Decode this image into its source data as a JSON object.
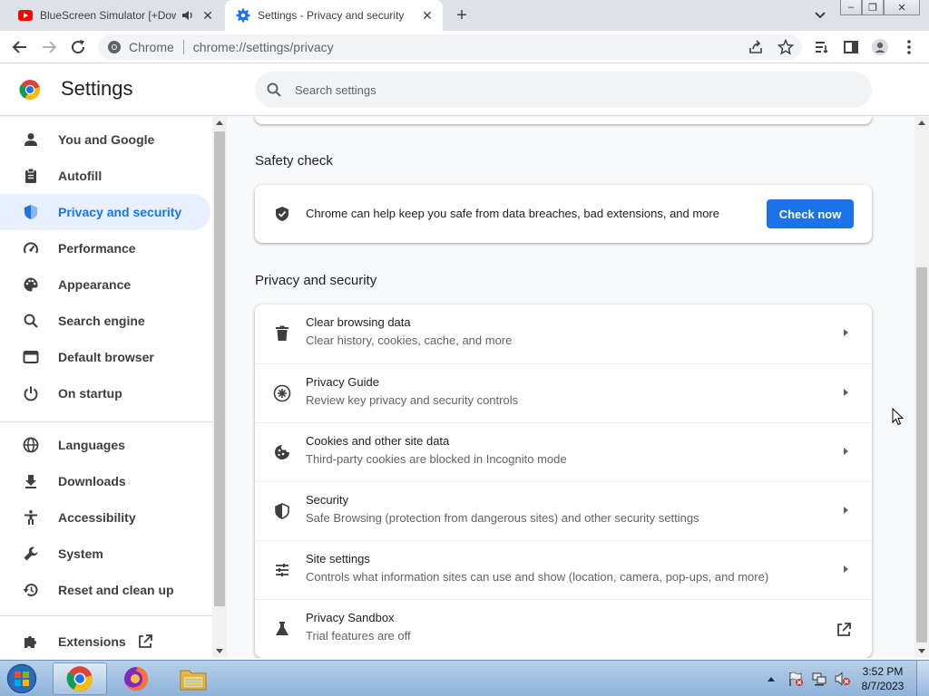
{
  "tabs": [
    {
      "title": "BlueScreen Simulator [+Dow",
      "favicon": "youtube-icon",
      "audio": "speaker-icon"
    },
    {
      "title": "Settings - Privacy and security",
      "favicon": "gear-icon"
    }
  ],
  "omnibox": {
    "chrome_label": "Chrome",
    "url": "chrome://settings/privacy"
  },
  "header": {
    "title": "Settings",
    "search_placeholder": "Search settings"
  },
  "sidebar": {
    "items": [
      {
        "label": "You and Google",
        "icon": "person-icon"
      },
      {
        "label": "Autofill",
        "icon": "clipboard-icon"
      },
      {
        "label": "Privacy and security",
        "icon": "shield-icon",
        "active": true
      },
      {
        "label": "Performance",
        "icon": "speedometer-icon"
      },
      {
        "label": "Appearance",
        "icon": "palette-icon"
      },
      {
        "label": "Search engine",
        "icon": "search-icon"
      },
      {
        "label": "Default browser",
        "icon": "browser-window-icon"
      },
      {
        "label": "On startup",
        "icon": "power-icon"
      },
      {
        "label": "Languages",
        "icon": "globe-icon"
      },
      {
        "label": "Downloads",
        "icon": "download-icon"
      },
      {
        "label": "Accessibility",
        "icon": "accessibility-icon"
      },
      {
        "label": "System",
        "icon": "wrench-icon"
      },
      {
        "label": "Reset and clean up",
        "icon": "restore-icon"
      },
      {
        "label": "Extensions",
        "icon": "puzzle-icon"
      }
    ]
  },
  "safety_check": {
    "section_title": "Safety check",
    "text": "Chrome can help keep you safe from data breaches, bad extensions, and more",
    "button": "Check now"
  },
  "privacy": {
    "section_title": "Privacy and security",
    "rows": [
      {
        "title": "Clear browsing data",
        "subtitle": "Clear history, cookies, cache, and more",
        "icon": "trash-icon"
      },
      {
        "title": "Privacy Guide",
        "subtitle": "Review key privacy and security controls",
        "icon": "compass-icon"
      },
      {
        "title": "Cookies and other site data",
        "subtitle": "Third-party cookies are blocked in Incognito mode",
        "icon": "cookie-icon"
      },
      {
        "title": "Security",
        "subtitle": "Safe Browsing (protection from dangerous sites) and other security settings",
        "icon": "shield-icon"
      },
      {
        "title": "Site settings",
        "subtitle": "Controls what information sites can use and show (location, camera, pop-ups, and more)",
        "icon": "sliders-icon"
      },
      {
        "title": "Privacy Sandbox",
        "subtitle": "Trial features are off",
        "icon": "flask-icon"
      }
    ]
  },
  "taskbar": {
    "time": "3:52 PM",
    "date": "8/7/2023"
  },
  "colors": {
    "accent": "#1a73e8",
    "active_nav_bg": "#e8f0fe"
  }
}
